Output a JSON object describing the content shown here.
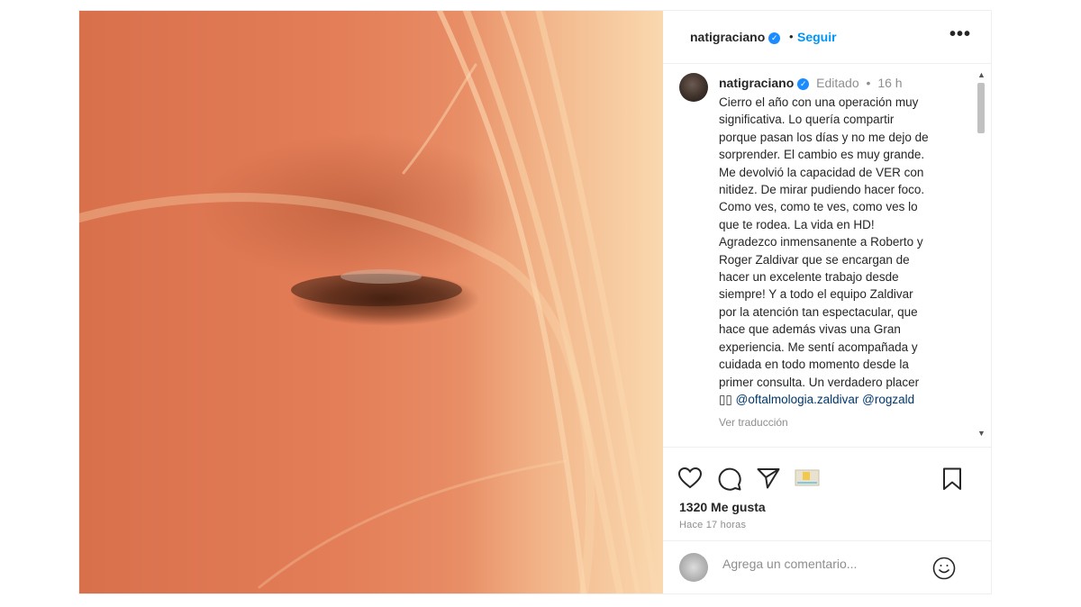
{
  "post": {
    "username": "natigraciano",
    "follow_label": "Seguir",
    "more_label": "•••",
    "caption": {
      "edited": "Editado",
      "time": "16 h",
      "lines": [
        "Cierro el año con una operación muy",
        "significativa. Lo quería compartir",
        "porque pasan los días y no me dejo de",
        "sorprender. El cambio es muy grande.",
        "Me devolvió la capacidad de VER con",
        "nitidez. De mirar pudiendo hacer foco.",
        "Como ves, como te ves, como ves lo",
        "que te rodea. La vida en HD!",
        "Agradezco inmensanente a Roberto y",
        "Roger Zaldivar que se encargan de",
        "hacer un excelente trabajo desde",
        "siempre! Y a todo el equipo Zaldivar",
        "por la atención tan espectacular, que",
        "hace que además vivas una Gran",
        "experiencia. Me sentí acompañada y",
        "cuidada en todo momento desde la",
        "primer consulta. Un verdadero placer"
      ],
      "last_line_prefix": "▯▯",
      "mention_1": "@oftalmologia.zaldivar",
      "mention_2": "@rogzald",
      "translate_label": "Ver traducción"
    },
    "likes": "1320 Me gusta",
    "posted_ago": "Hace 17 horas",
    "comment_placeholder": "Agrega un comentario..."
  },
  "colors": {
    "accent": "#0095f6",
    "verified": "#1a8cff",
    "muted": "#8e8e8e",
    "mention": "#00376b"
  },
  "icons": [
    "verified-icon",
    "more-icon",
    "heart-icon",
    "comment-icon",
    "share-icon",
    "sticker-icon",
    "bookmark-icon",
    "emoji-icon"
  ]
}
